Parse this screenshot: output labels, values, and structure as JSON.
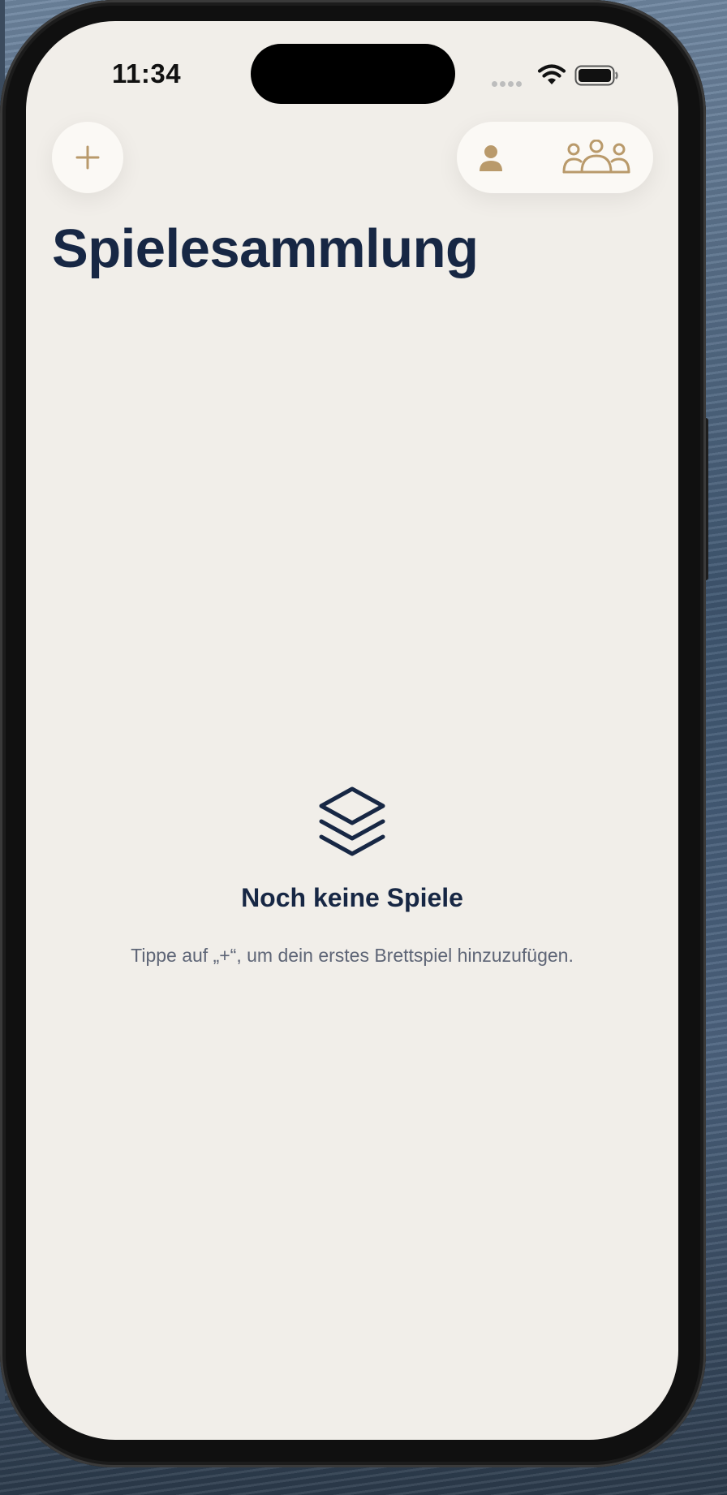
{
  "status_bar": {
    "time": "11:34"
  },
  "toolbar": {
    "add_icon": "plus-icon",
    "person_icon": "person-fill-icon",
    "group_icon": "person-3-icon"
  },
  "page": {
    "title": "Spielesammlung"
  },
  "empty_state": {
    "icon": "stack-icon",
    "title": "Noch keine Spiele",
    "hint": "Tippe auf „+“, um dein erstes Brettspiel hinzuzufügen."
  },
  "colors": {
    "background": "#f1eee9",
    "navy": "#172744",
    "accent_gold": "#b99a6b",
    "button_fill": "#fbf9f5"
  }
}
